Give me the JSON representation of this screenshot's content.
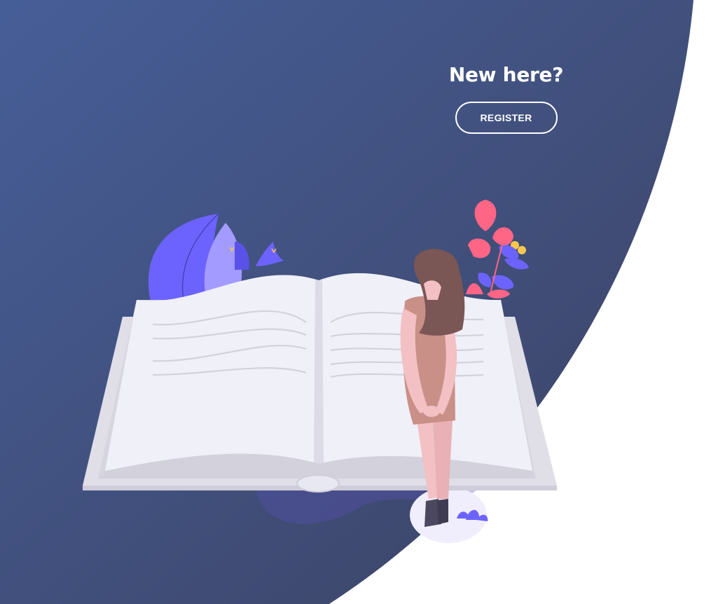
{
  "panel": {
    "title": "New here?",
    "register_label": "REGISTER"
  },
  "colors": {
    "panel_gradient_start": "#445b95",
    "panel_gradient_end": "#3e4466",
    "accent_purple": "#6c63ff",
    "accent_pink": "#ff6584",
    "page_white": "#ffffff"
  },
  "illustration": {
    "name": "woman-reading-open-book",
    "icons": [
      "open-book-icon",
      "woman-figure-icon",
      "leaf-plant-icon",
      "flower-plant-icon",
      "bird-icon"
    ]
  }
}
